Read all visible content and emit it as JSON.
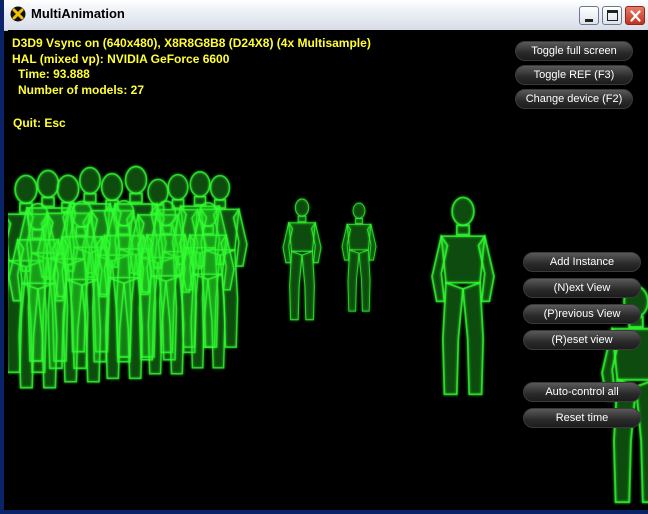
{
  "window": {
    "title": "MultiAnimation"
  },
  "hud": {
    "stats_line1": "D3D9 Vsync on (640x480), X8R8G8B8 (D24X8) (4x Multisample)",
    "stats_line2": "HAL (mixed vp): NVIDIA GeForce 6600",
    "time": "Time: 93.888",
    "models": "Number of models: 27",
    "quit": "Quit: Esc"
  },
  "buttons": {
    "toggle_full_screen": "Toggle full screen",
    "toggle_ref": "Toggle REF (F3)",
    "change_device": "Change device (F2)",
    "add_instance": "Add Instance",
    "next_view": "(N)ext View",
    "previous_view": "(P)revious View",
    "reset_view": "(R)eset view",
    "auto_control_all": "Auto-control all",
    "reset_time": "Reset time"
  },
  "colors": {
    "hud_text": "#ffff33",
    "model_glow": "#33ff33"
  }
}
